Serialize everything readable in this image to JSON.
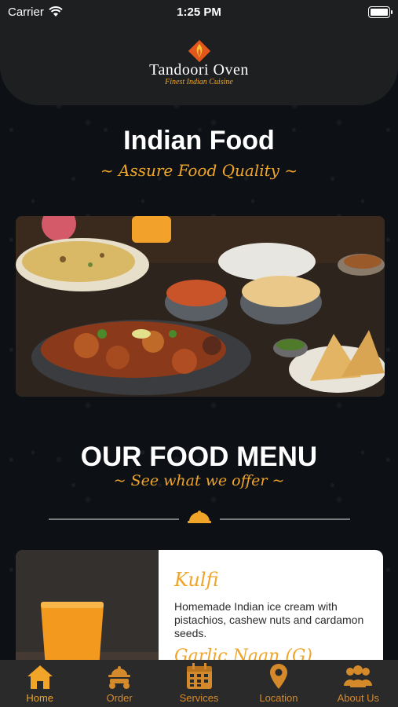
{
  "status_bar": {
    "carrier": "Carrier",
    "time": "1:25 PM"
  },
  "header": {
    "brand_name": "Tandoori Oven",
    "brand_tagline": "Finest Indian Cuisine"
  },
  "hero": {
    "title": "Indian Food",
    "subtitle": "~ Assure Food Quality ~"
  },
  "menu_section": {
    "title": "OUR FOOD MENU",
    "subtitle": "~ See what we offer ~"
  },
  "menu_items": [
    {
      "name": "Kulfi",
      "description": "Homemade Indian ice cream with pistachios, cashew nuts and cardamon seeds."
    },
    {
      "name": "Garlic Naan (G)"
    }
  ],
  "tabs": [
    {
      "label": "Home",
      "icon": "home-icon",
      "active": true
    },
    {
      "label": "Order",
      "icon": "delivery-scooter-icon",
      "active": false
    },
    {
      "label": "Services",
      "icon": "calendar-icon",
      "active": false
    },
    {
      "label": "Location",
      "icon": "map-pin-icon",
      "active": false
    },
    {
      "label": "About Us",
      "icon": "people-icon",
      "active": false
    }
  ],
  "colors": {
    "accent": "#f0a528",
    "background": "#0d1116",
    "tab_bar": "#2a2a2a"
  }
}
